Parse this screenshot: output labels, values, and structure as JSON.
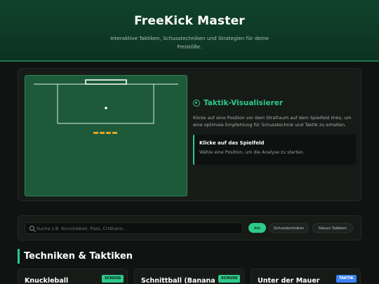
{
  "header": {
    "title": "FreeKick Master",
    "subtitle": "Interaktive Taktiken, Schusstechniken und Strategien für deine Freistöße."
  },
  "visualizer": {
    "title": "Taktik-Visualisierer",
    "description": "Klicke auf eine Position vor dem Strafraum auf dem Spielfeld links, um eine optimale Empfehlung für Schusstechnik und Taktik zu erhalten.",
    "hint_title": "Klicke auf das Spielfeld",
    "hint_text": "Wähle eine Position, um die Analyse zu starten."
  },
  "filters": {
    "search_placeholder": "Suche z.B. Knuckleball, Pass, Cristiano...",
    "options": [
      "Alle",
      "Schusstechniken",
      "Mauer-Taktiken"
    ],
    "active": "Alle"
  },
  "section": {
    "title": "Techniken & Taktiken"
  },
  "cards": [
    {
      "title": "Knuckleball",
      "badge": "SCHUSS",
      "badge_kind": "shot"
    },
    {
      "title": "Schnittball (Banana",
      "badge": "SCHUSS",
      "badge_kind": "shot"
    },
    {
      "title": "Unter der Mauer",
      "badge": "TAKTIK",
      "badge_kind": "tactic"
    }
  ],
  "colors": {
    "accent": "#2fc98a",
    "header_bg": "#10432c",
    "pitch": "#1c5a3a",
    "wall": "#e0a526",
    "tactic_badge": "#3b82f6"
  },
  "icons": {
    "visualizer_title": "target-icon",
    "search": "search-icon"
  }
}
